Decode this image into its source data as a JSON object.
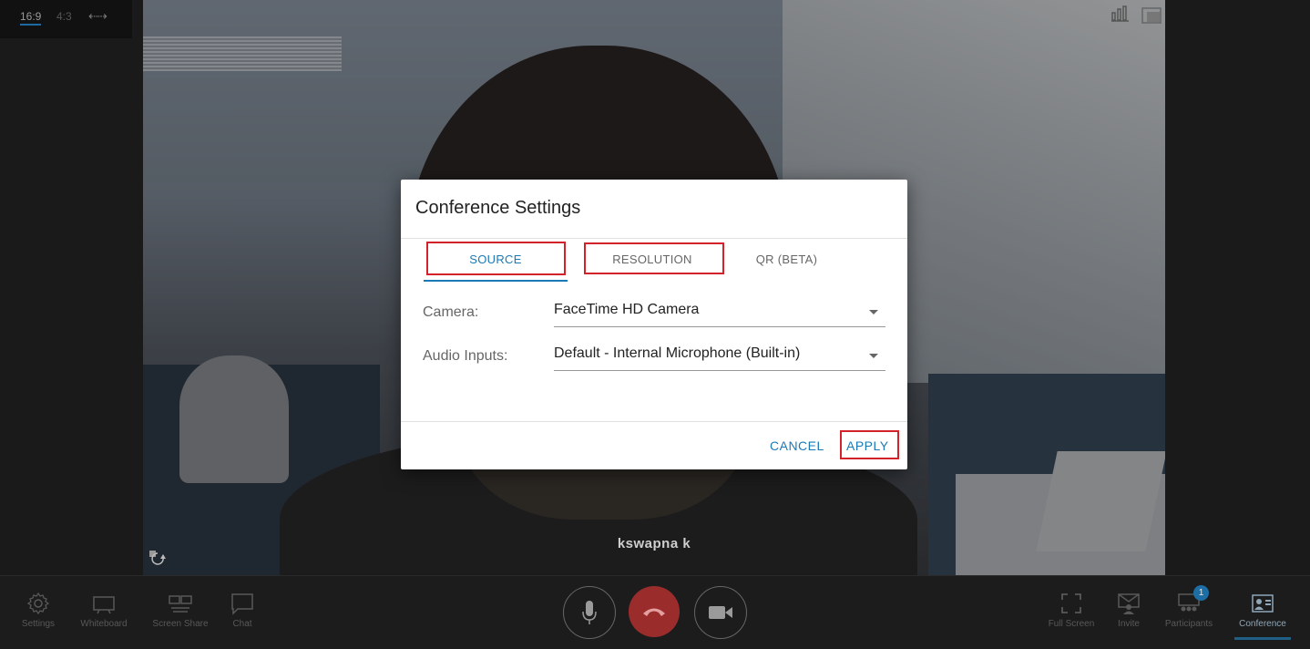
{
  "aspect": {
    "ratio_169": "16:9",
    "ratio_43": "4:3",
    "swap_glyph": "⇠⇢"
  },
  "video": {
    "participant_name": "kswapna k"
  },
  "modal": {
    "title": "Conference Settings",
    "tabs": [
      {
        "label": "SOURCE",
        "active": true
      },
      {
        "label": "RESOLUTION",
        "active": false
      },
      {
        "label": "QR (BETA)",
        "active": false
      }
    ],
    "fields": {
      "camera_label": "Camera:",
      "camera_value": "FaceTime HD Camera",
      "audio_label": "Audio Inputs:",
      "audio_value": "Default - Internal Microphone (Built-in)"
    },
    "buttons": {
      "cancel": "CANCEL",
      "apply": "APPLY"
    }
  },
  "toolbar": {
    "left": [
      {
        "label": "Settings",
        "icon": "gear-icon"
      },
      {
        "label": "Whiteboard",
        "icon": "whiteboard-icon"
      },
      {
        "label": "Screen Share",
        "icon": "screen-share-icon"
      },
      {
        "label": "Chat",
        "icon": "chat-icon"
      }
    ],
    "right": [
      {
        "label": "Full Screen",
        "icon": "fullscreen-icon"
      },
      {
        "label": "Invite",
        "icon": "invite-icon"
      },
      {
        "label": "Participants",
        "icon": "participants-icon",
        "badge": "1"
      },
      {
        "label": "Conference",
        "icon": "conference-icon",
        "active": true
      }
    ]
  },
  "colors": {
    "accent": "#1b7ab5",
    "end_call": "#9b2c2c",
    "highlight": "#d4222a"
  }
}
